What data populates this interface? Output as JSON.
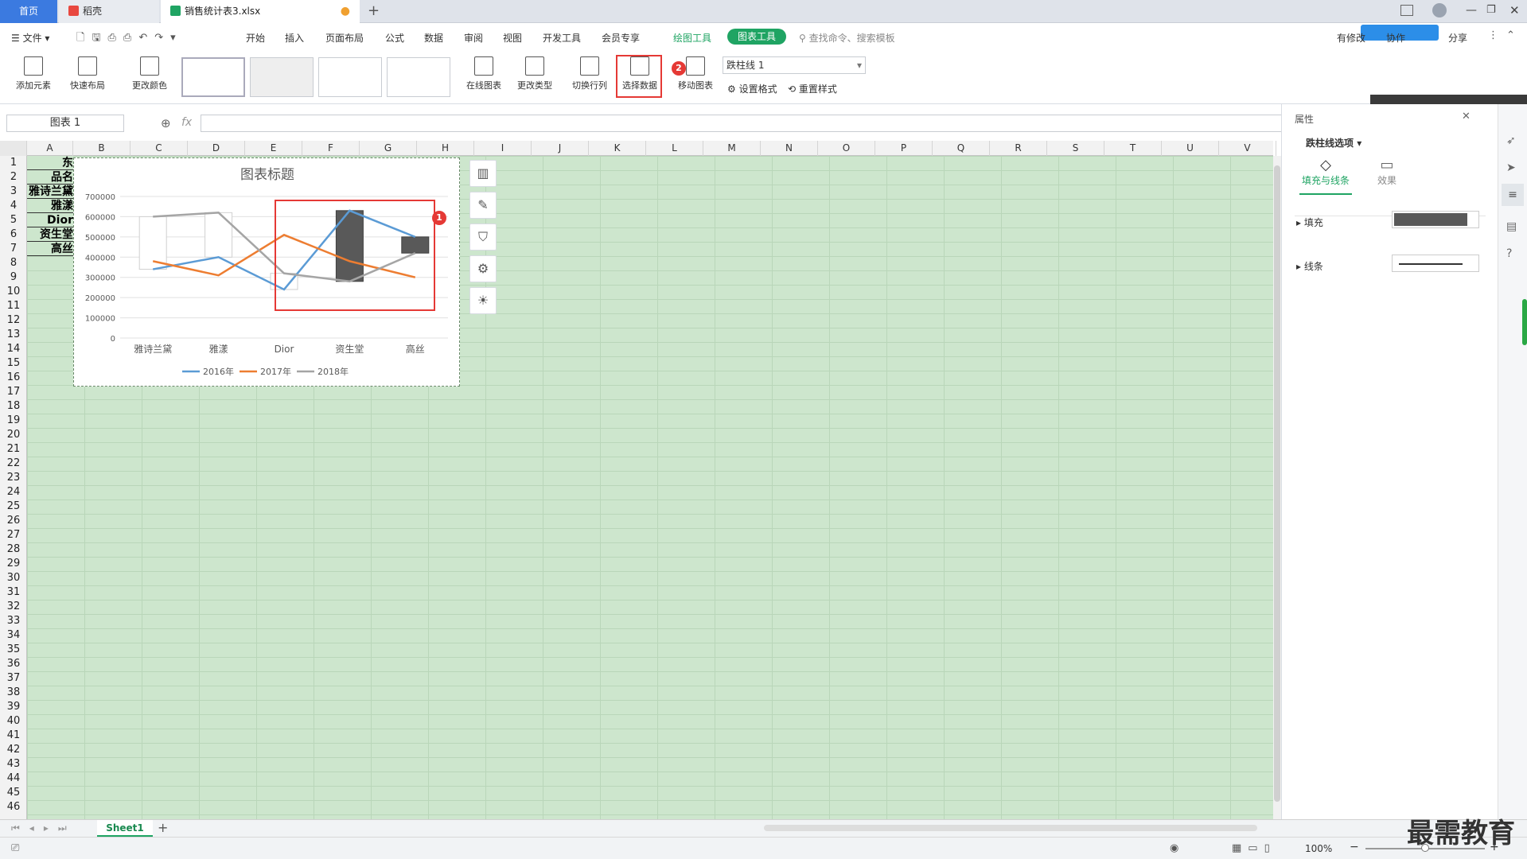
{
  "tabs": {
    "home": "首页",
    "shell": "稻壳",
    "file": "销售统计表3.xlsx"
  },
  "menubar": {
    "file": "文件",
    "items": [
      "开始",
      "插入",
      "页面布局",
      "公式",
      "数据",
      "审阅",
      "视图",
      "开发工具",
      "会员专享"
    ],
    "drawing_tool": "绘图工具",
    "chart_tool": "图表工具",
    "search": "查找命令、搜索模板",
    "share": "分享",
    "modified": "有修改",
    "collab": "协作"
  },
  "ribbon": {
    "add_element": "添加元素",
    "quick_layout": "快速布局",
    "change_color": "更改颜色",
    "online_chart": "在线图表",
    "change_type": "更改类型",
    "switch_rowcol": "切换行列",
    "select_data": "选择数据",
    "move_chart": "移动图表",
    "element_select": "跌柱线 1",
    "set_format": "设置格式",
    "reset_style": "重置样式"
  },
  "formula": {
    "namebox": "图表 1",
    "fx": "fx"
  },
  "columns": [
    "A",
    "B",
    "C",
    "D",
    "E",
    "F",
    "G",
    "H",
    "I",
    "J",
    "K",
    "L",
    "M",
    "N",
    "O",
    "P",
    "Q",
    "R",
    "S",
    "T",
    "U",
    "V"
  ],
  "cellsA": [
    "东",
    "品名",
    "雅诗兰黛",
    "雅漾",
    "Dior",
    "资生堂",
    "高丝"
  ],
  "chart_data": {
    "type": "line",
    "title": "图表标题",
    "categories": [
      "雅诗兰黛",
      "雅漾",
      "Dior",
      "资生堂",
      "高丝"
    ],
    "series": [
      {
        "name": "2016年",
        "values": [
          340000,
          400000,
          240000,
          630000,
          500000
        ],
        "color": "#5b9bd5"
      },
      {
        "name": "2017年",
        "values": [
          380000,
          310000,
          510000,
          380000,
          300000
        ],
        "color": "#ed7d31"
      },
      {
        "name": "2018年",
        "values": [
          600000,
          620000,
          320000,
          280000,
          420000
        ],
        "color": "#a5a5a5"
      }
    ],
    "ylim": [
      0,
      700000
    ],
    "yticks": [
      "700000",
      "600000",
      "500000",
      "400000",
      "300000",
      "200000",
      "100000",
      "0"
    ],
    "legend": "bottom"
  },
  "badges": {
    "one": "1",
    "two": "2"
  },
  "rpanel": {
    "title": "属性",
    "dropdown": "跌柱线选项",
    "tab_fill": "填充与线条",
    "tab_effect": "效果",
    "fill": "填充",
    "line": "线条"
  },
  "sheet": {
    "name": "Sheet1"
  },
  "status": {
    "zoom": "100%"
  },
  "watermark": "最需教育"
}
